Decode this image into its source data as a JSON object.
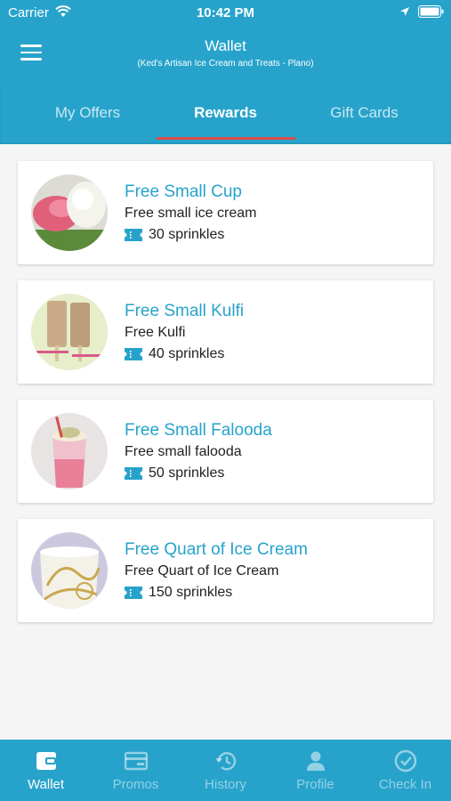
{
  "status_bar": {
    "carrier": "Carrier",
    "time": "10:42 PM"
  },
  "nav": {
    "title": "Wallet",
    "subtitle": "(Ked's Artisan Ice Cream and Treats - Plano)"
  },
  "tabs": [
    {
      "label": "My Offers",
      "active": false
    },
    {
      "label": "Rewards",
      "active": true
    },
    {
      "label": "Gift Cards",
      "active": false
    }
  ],
  "rewards": [
    {
      "title": "Free Small Cup",
      "description": "Free small ice cream",
      "points": "30 sprinkles"
    },
    {
      "title": "Free Small Kulfi",
      "description": "Free Kulfi",
      "points": "40 sprinkles"
    },
    {
      "title": "Free Small Falooda",
      "description": "Free small falooda",
      "points": "50 sprinkles"
    },
    {
      "title": "Free Quart of Ice Cream",
      "description": "Free Quart of Ice Cream",
      "points": "150 sprinkles"
    }
  ],
  "tabbar": [
    {
      "label": "Wallet",
      "icon": "wallet-icon",
      "active": true
    },
    {
      "label": "Promos",
      "icon": "promo-card-icon",
      "active": false
    },
    {
      "label": "History",
      "icon": "history-icon",
      "active": false
    },
    {
      "label": "Profile",
      "icon": "profile-icon",
      "active": false
    },
    {
      "label": "Check In",
      "icon": "check-circle-icon",
      "active": false
    }
  ],
  "colors": {
    "primary": "#27a3cb",
    "tab_indicator": "#d94b4b",
    "background": "#f5f5f5"
  }
}
